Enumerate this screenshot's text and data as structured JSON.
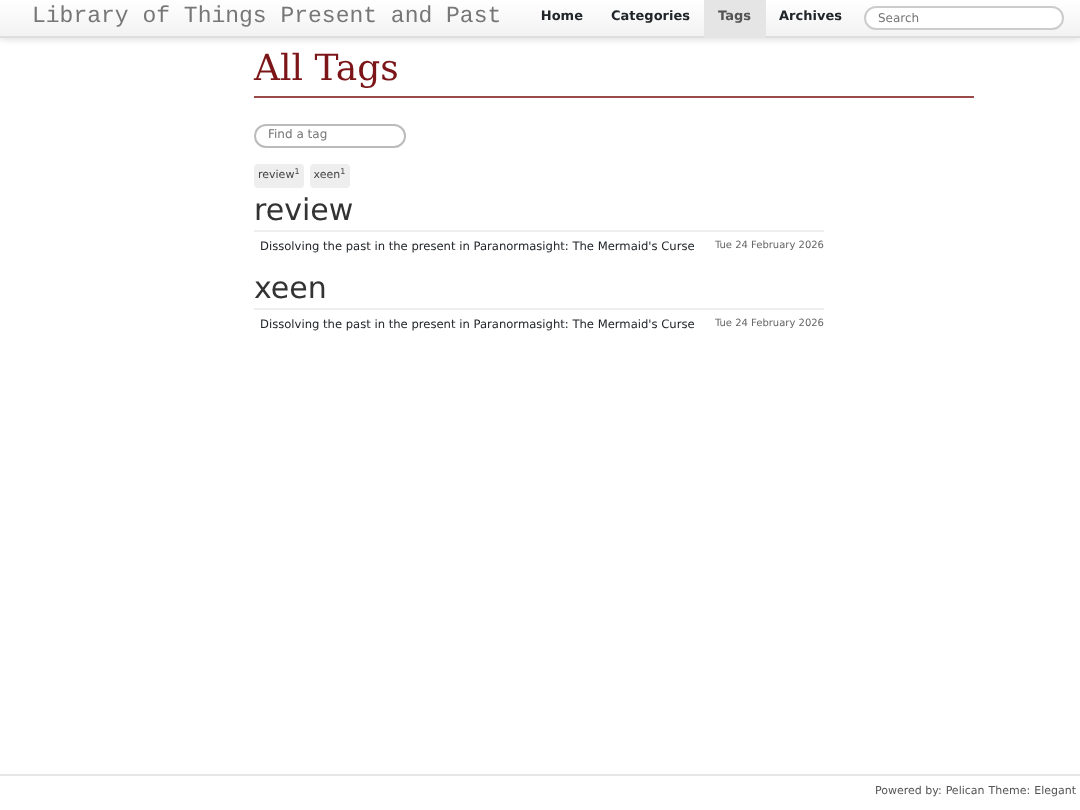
{
  "site_title": "Library of Things Present and Past",
  "nav": [
    {
      "label": "Home",
      "selected": false
    },
    {
      "label": "Categories",
      "selected": false
    },
    {
      "label": "Tags",
      "selected": true
    },
    {
      "label": "Archives",
      "selected": false
    }
  ],
  "search": {
    "placeholder": "Search"
  },
  "heading": "All Tags",
  "tag_filter": {
    "placeholder": "Find a tag"
  },
  "tag_cloud": [
    {
      "name": "review",
      "count": "1"
    },
    {
      "name": "xeen",
      "count": "1"
    }
  ],
  "sections": [
    {
      "tag": "review",
      "articles": [
        {
          "title": "Dissolving the past in the present in Paranormasight: The Mermaid's Curse",
          "date": "Tue 24 February 2026"
        }
      ]
    },
    {
      "tag": "xeen",
      "articles": [
        {
          "title": "Dissolving the past in the present in Paranormasight: The Mermaid's Curse",
          "date": "Tue 24 February 2026"
        }
      ]
    }
  ],
  "footer": {
    "prefix": "Powered by:",
    "engine": "Pelican",
    "theme_label": "Theme:",
    "theme": "Elegant"
  }
}
